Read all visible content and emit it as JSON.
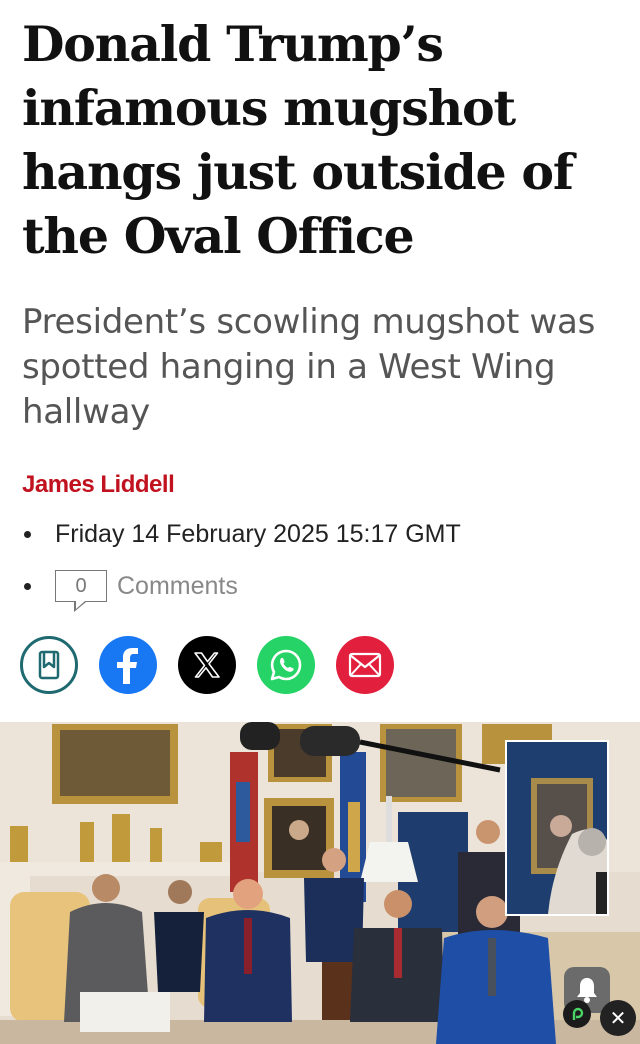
{
  "article": {
    "headline": "Donald Trump’s infamous mugshot hangs just outside of the Oval Office",
    "standfirst": "President’s scowling mugshot was spotted hanging in a West Wing hallway",
    "author": "James Liddell",
    "date": "Friday 14 February 2025 15:17 GMT",
    "comments_count": "0",
    "comments_label": "Comments"
  },
  "share": {
    "icons": [
      "bookmark-icon",
      "facebook-icon",
      "x-icon",
      "whatsapp-icon",
      "email-icon"
    ],
    "colors": {
      "bookmark": "#1f6a70",
      "facebook": "#1877f2",
      "x": "#000000",
      "whatsapp": "#25d366",
      "email": "#e21f3d"
    }
  },
  "colors": {
    "author": "#c1121f",
    "standfirst": "#555555",
    "headline": "#111111"
  },
  "overlay": {
    "close_icon": "close-icon",
    "alert_icon": "bell-icon"
  }
}
